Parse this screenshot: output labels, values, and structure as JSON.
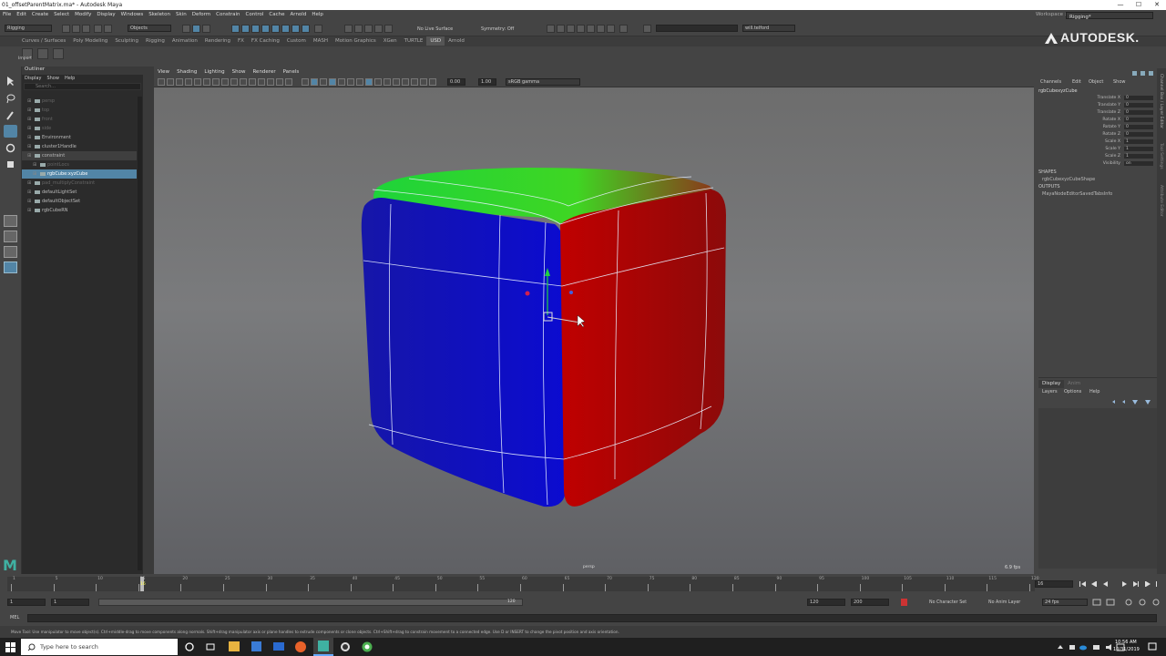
{
  "window": {
    "title": "01_offsetParentMatrix.ma* - Autodesk Maya",
    "min": "—",
    "max": "☐",
    "close": "✕"
  },
  "menu": [
    "File",
    "Edit",
    "Create",
    "Select",
    "Modify",
    "Display",
    "Windows",
    "Skeleton",
    "Skin",
    "Deform",
    "Constrain",
    "Control",
    "Cache",
    "Arnold",
    "Help"
  ],
  "status": {
    "mode": "Rigging",
    "objects": "Objects",
    "live": "No Live Surface",
    "symmetry": "Symmetry: Off",
    "user": "will.telford",
    "workspace_label": "Workspace :",
    "workspace": "Rigging*"
  },
  "shelf_tabs": [
    "Curves / Surfaces",
    "Poly Modeling",
    "Sculpting",
    "Rigging",
    "Animation",
    "Rendering",
    "FX",
    "FX Caching",
    "Custom",
    "MASH",
    "Motion Graphics",
    "XGen",
    "TURTLE",
    "USD",
    "Arnold"
  ],
  "shelf_active": "USD",
  "shelf_label": "Import",
  "brand": "AUTODESK.",
  "outliner": {
    "title": "Outliner",
    "menu": [
      "Display",
      "Show",
      "Help"
    ],
    "search": "Search...",
    "items": [
      {
        "label": "persp",
        "indent": 1,
        "state": "dim"
      },
      {
        "label": "top",
        "indent": 1,
        "state": "dim"
      },
      {
        "label": "front",
        "indent": 1,
        "state": "dim"
      },
      {
        "label": "side",
        "indent": 1,
        "state": "dim"
      },
      {
        "label": "Environment",
        "indent": 1,
        "state": ""
      },
      {
        "label": "cluster1Handle",
        "indent": 1,
        "state": ""
      },
      {
        "label": "constraint",
        "indent": 1,
        "state": "hl"
      },
      {
        "label": "pointLocs",
        "indent": 2,
        "state": "dim"
      },
      {
        "label": "rgbCube:xyzCube",
        "indent": 2,
        "state": "sel"
      },
      {
        "label": "pad_multiplyConstraint",
        "indent": 1,
        "state": "dim"
      },
      {
        "label": "defaultLightSet",
        "indent": 1,
        "state": ""
      },
      {
        "label": "defaultObjectSet",
        "indent": 1,
        "state": ""
      },
      {
        "label": "rgbCubeRN",
        "indent": 1,
        "state": ""
      }
    ]
  },
  "vpmenu": [
    "View",
    "Shading",
    "Lighting",
    "Show",
    "Renderer",
    "Panels"
  ],
  "vptool": {
    "val1": "0.00",
    "val2": "1.00",
    "colorspace": "sRGB gamma"
  },
  "viewport": {
    "camera": "persp",
    "fps": "6.9 fps"
  },
  "channelbox": {
    "menu": [
      "Channels",
      "Edit",
      "Object",
      "Show"
    ],
    "node": "rgbCubexyzCube",
    "channels": [
      {
        "name": "Translate X",
        "value": "0"
      },
      {
        "name": "Translate Y",
        "value": "0"
      },
      {
        "name": "Translate Z",
        "value": "0"
      },
      {
        "name": "Rotate X",
        "value": "0"
      },
      {
        "name": "Rotate Y",
        "value": "0"
      },
      {
        "name": "Rotate Z",
        "value": "0"
      },
      {
        "name": "Scale X",
        "value": "1"
      },
      {
        "name": "Scale Y",
        "value": "1"
      },
      {
        "name": "Scale Z",
        "value": "1"
      },
      {
        "name": "Visibility",
        "value": "on"
      }
    ],
    "shapes_label": "SHAPES",
    "shape": "rgbCubexyzCubeShape",
    "outputs_label": "OUTPUTS",
    "output": "MayaNodeEditorSavedTabsInfo",
    "layer_tabs": [
      "Display",
      "Anim"
    ],
    "layer_menu": [
      "Layers",
      "Options",
      "Help"
    ]
  },
  "side_tabs": [
    "Channel Box / Layer Editor",
    "Tool Settings",
    "Attribute Editor"
  ],
  "timeline": {
    "current": "16",
    "ticks": [
      "1",
      "5",
      "10",
      "15",
      "20",
      "25",
      "30",
      "35",
      "40",
      "45",
      "50",
      "55",
      "60",
      "65",
      "70",
      "75",
      "80",
      "85",
      "90",
      "95",
      "100",
      "105",
      "110",
      "115",
      "120"
    ],
    "frame_field": "16"
  },
  "range": {
    "start": "1",
    "start2": "1",
    "end_inner": "120",
    "end": "120",
    "end2": "200",
    "charset": "No Character Set",
    "animlayer": "No Anim Layer",
    "fps": "24 fps"
  },
  "cmd": {
    "lang": "MEL"
  },
  "help": "Move Tool: Use manipulator to move object(s). Ctrl+middle-drag to move components along normals. Shift+drag manipulator axis or plane handles to extrude components or clone objects. Ctrl+Shift+drag to constrain movement to a connected edge. Use D or INSERT to change the pivot position and axis orientation.",
  "taskbar": {
    "search": "Type here to search",
    "time": "10:56 AM",
    "date": "10/31/2019"
  }
}
